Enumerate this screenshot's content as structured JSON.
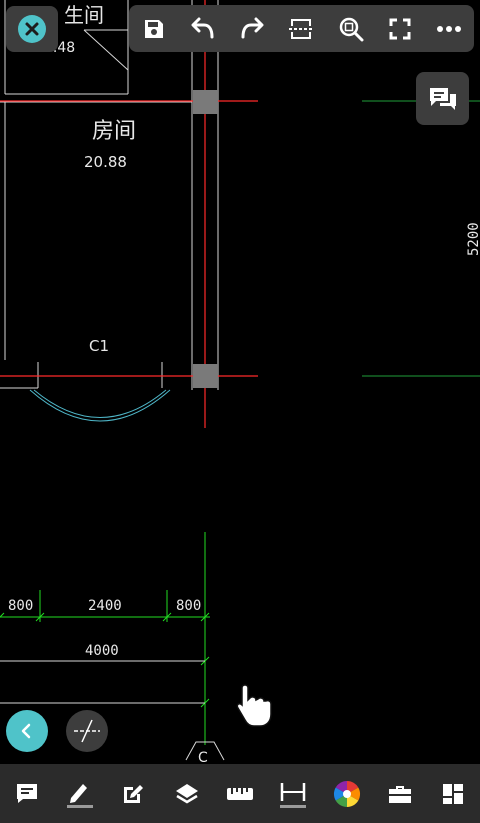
{
  "drawing": {
    "room_label_top": "生间",
    "room_area_top": "5.48",
    "room_label": "房间",
    "room_area": "20.88",
    "door_label": "C1",
    "axis_label": "C",
    "side_dimension": "5200",
    "dimensions": {
      "left": "800",
      "middle": "2400",
      "right": "800",
      "total": "4000"
    }
  },
  "toolbar": {
    "close_icon": "close-icon",
    "items": [
      "save-icon",
      "undo-icon",
      "redo-icon",
      "crop-icon",
      "zoom-fit-icon",
      "fullscreen-icon",
      "more-icon"
    ]
  },
  "bottom_toolbar": {
    "items": [
      "comment-icon",
      "pencil-icon",
      "edit-icon",
      "layers-icon",
      "ruler-icon",
      "dimension-icon",
      "color-wheel-icon",
      "toolbox-icon",
      "layout-icon"
    ]
  },
  "colors": {
    "accent": "#4fc3c9",
    "button_bg": "#3d3d3d",
    "bottom_bar_bg": "#2b2b2b",
    "wall": "#ff2a2a",
    "dimension": "#22dd22",
    "line": "#d9d9d9",
    "hatch": "#7a7a7a"
  }
}
